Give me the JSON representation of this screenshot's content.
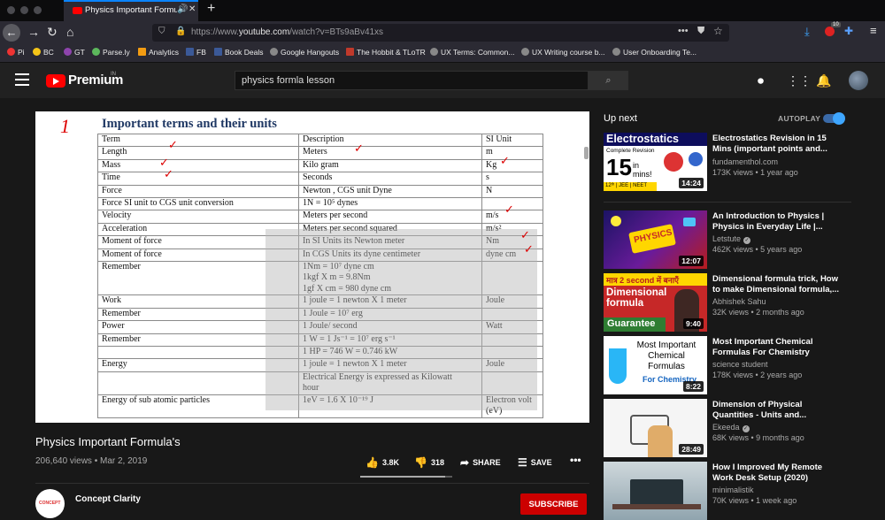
{
  "browser": {
    "tab_title": "Physics Important Formula's",
    "url_prefix": "https://www.",
    "url_domain": "youtube.com",
    "url_path": "/watch?v=BTs9aBv41xs",
    "bookmarks": [
      "Pi",
      "BC",
      "GT",
      "Parse.ly",
      "Analytics",
      "FB",
      "Book Deals",
      "Google Hangouts",
      "The Hobbit & TLoTR",
      "UX Terms: Common...",
      "UX Writing course b...",
      "User Onboarding Te..."
    ],
    "badge_count": "10"
  },
  "youtube": {
    "logo_text": "Premium",
    "logo_region": "IN",
    "search_value": "physics formla lesson"
  },
  "slide": {
    "marker": "1",
    "title": "Important terms and their units",
    "rows": [
      [
        "Term",
        "Description",
        "SI Unit"
      ],
      [
        "Length",
        "Meters",
        "m"
      ],
      [
        "Mass",
        "Kilo gram",
        "Kg"
      ],
      [
        "Time",
        "Seconds",
        "s"
      ],
      [
        "Force",
        "Newton , CGS unit Dyne",
        "N"
      ],
      [
        "Force SI unit to CGS unit conversion",
        "1N = 10⁵ dynes",
        ""
      ],
      [
        "Velocity",
        "Meters per second",
        "m/s"
      ],
      [
        "Acceleration",
        "Meters per second squared",
        "m/s²"
      ],
      [
        "Moment of force",
        "In SI Units its Newton meter",
        "Nm"
      ],
      [
        "Moment of force",
        "In CGS Units its dyne centimeter",
        "dyne cm"
      ],
      [
        "Remember",
        "1Nm = 10⁷ dyne cm\n1kgf X m = 9.8Nm\n1gf X cm = 980 dyne cm",
        ""
      ],
      [
        "Work",
        "1 joule = 1 newton X 1 meter",
        "Joule"
      ],
      [
        "Remember",
        "1 Joule = 10⁷ erg",
        ""
      ],
      [
        "Power",
        "1 Joule/ second",
        "Watt"
      ],
      [
        "Remember",
        "1 W = 1 Js⁻¹ = 10⁷ erg s⁻¹",
        ""
      ],
      [
        "",
        "1 HP = 746 W = 0.746 kW",
        ""
      ],
      [
        "Energy",
        "1 joule = 1 newton X 1 meter",
        "Joule"
      ],
      [
        "",
        "Electrical Energy is expressed as Kilowatt\nhour",
        ""
      ],
      [
        "Energy of sub atomic particles",
        "1eV = 1.6 X 10⁻¹⁹ J",
        "Electron volt\n(eV)"
      ]
    ]
  },
  "video": {
    "title": "Physics Important Formula's",
    "views": "206,640 views",
    "date": "Mar 2, 2019",
    "likes": "3.8K",
    "dislikes": "318",
    "share_label": "SHARE",
    "save_label": "SAVE",
    "like_ratio": 0.92,
    "channel_avatar_text": "CONCEPT",
    "channel": "Concept Clarity",
    "subscribe_label": "SUBSCRIBE"
  },
  "sidebar": {
    "up_next_label": "Up next",
    "autoplay_label": "AUTOPLAY",
    "autoplay_on": true,
    "videos": [
      {
        "title": "Electrostatics Revision in 15 Mins (important points and...",
        "channel": "fundamenthol.com",
        "verified": false,
        "meta": "173K views • 1 year ago",
        "duration": "14:24",
        "thumb_text": {
          "headline": "Electrostatics",
          "sub": "Complete Revision",
          "big": "15",
          "small": "in mins!",
          "foot": "12ᵗʰ | JEE | NEET"
        }
      },
      {
        "title": "An Introduction to Physics | Physics in Everyday Life |...",
        "channel": "Letstute",
        "verified": true,
        "meta": "462K views • 5 years ago",
        "duration": "12:07",
        "thumb_text": {
          "word": "PHYSICS"
        }
      },
      {
        "title": "Dimensional formula trick, How to make Dimensional formula,...",
        "channel": "Abhishek Sahu",
        "verified": false,
        "meta": "32K views • 2 months ago",
        "duration": "9:40",
        "thumb_text": {
          "top": "मात्र 2 second में बनाएँ",
          "mid": "Dimensional formula",
          "bottom": "Guarantee"
        }
      },
      {
        "title": "Most Important Chemical Formulas For Chemistry",
        "channel": "science student",
        "verified": false,
        "meta": "178K views • 2 years ago",
        "duration": "8:22",
        "thumb_text": {
          "line1": "Most Important",
          "line2": "Chemical",
          "line3": "Formulas",
          "line4": "For Chemistry"
        }
      },
      {
        "title": "Dimension of Physical Quantities - Units and...",
        "channel": "Ekeeda",
        "verified": true,
        "meta": "68K views • 9 months ago",
        "duration": "28:49"
      },
      {
        "title": "How I Improved My Remote Work Desk Setup (2020)",
        "channel": "minimalistik",
        "verified": false,
        "meta": "70K views • 1 week ago",
        "duration": ""
      }
    ]
  },
  "colors": {
    "brand": "#ff0000",
    "background": "#181818",
    "subscribe": "#cc0000",
    "accent": "#3ea6ff"
  }
}
